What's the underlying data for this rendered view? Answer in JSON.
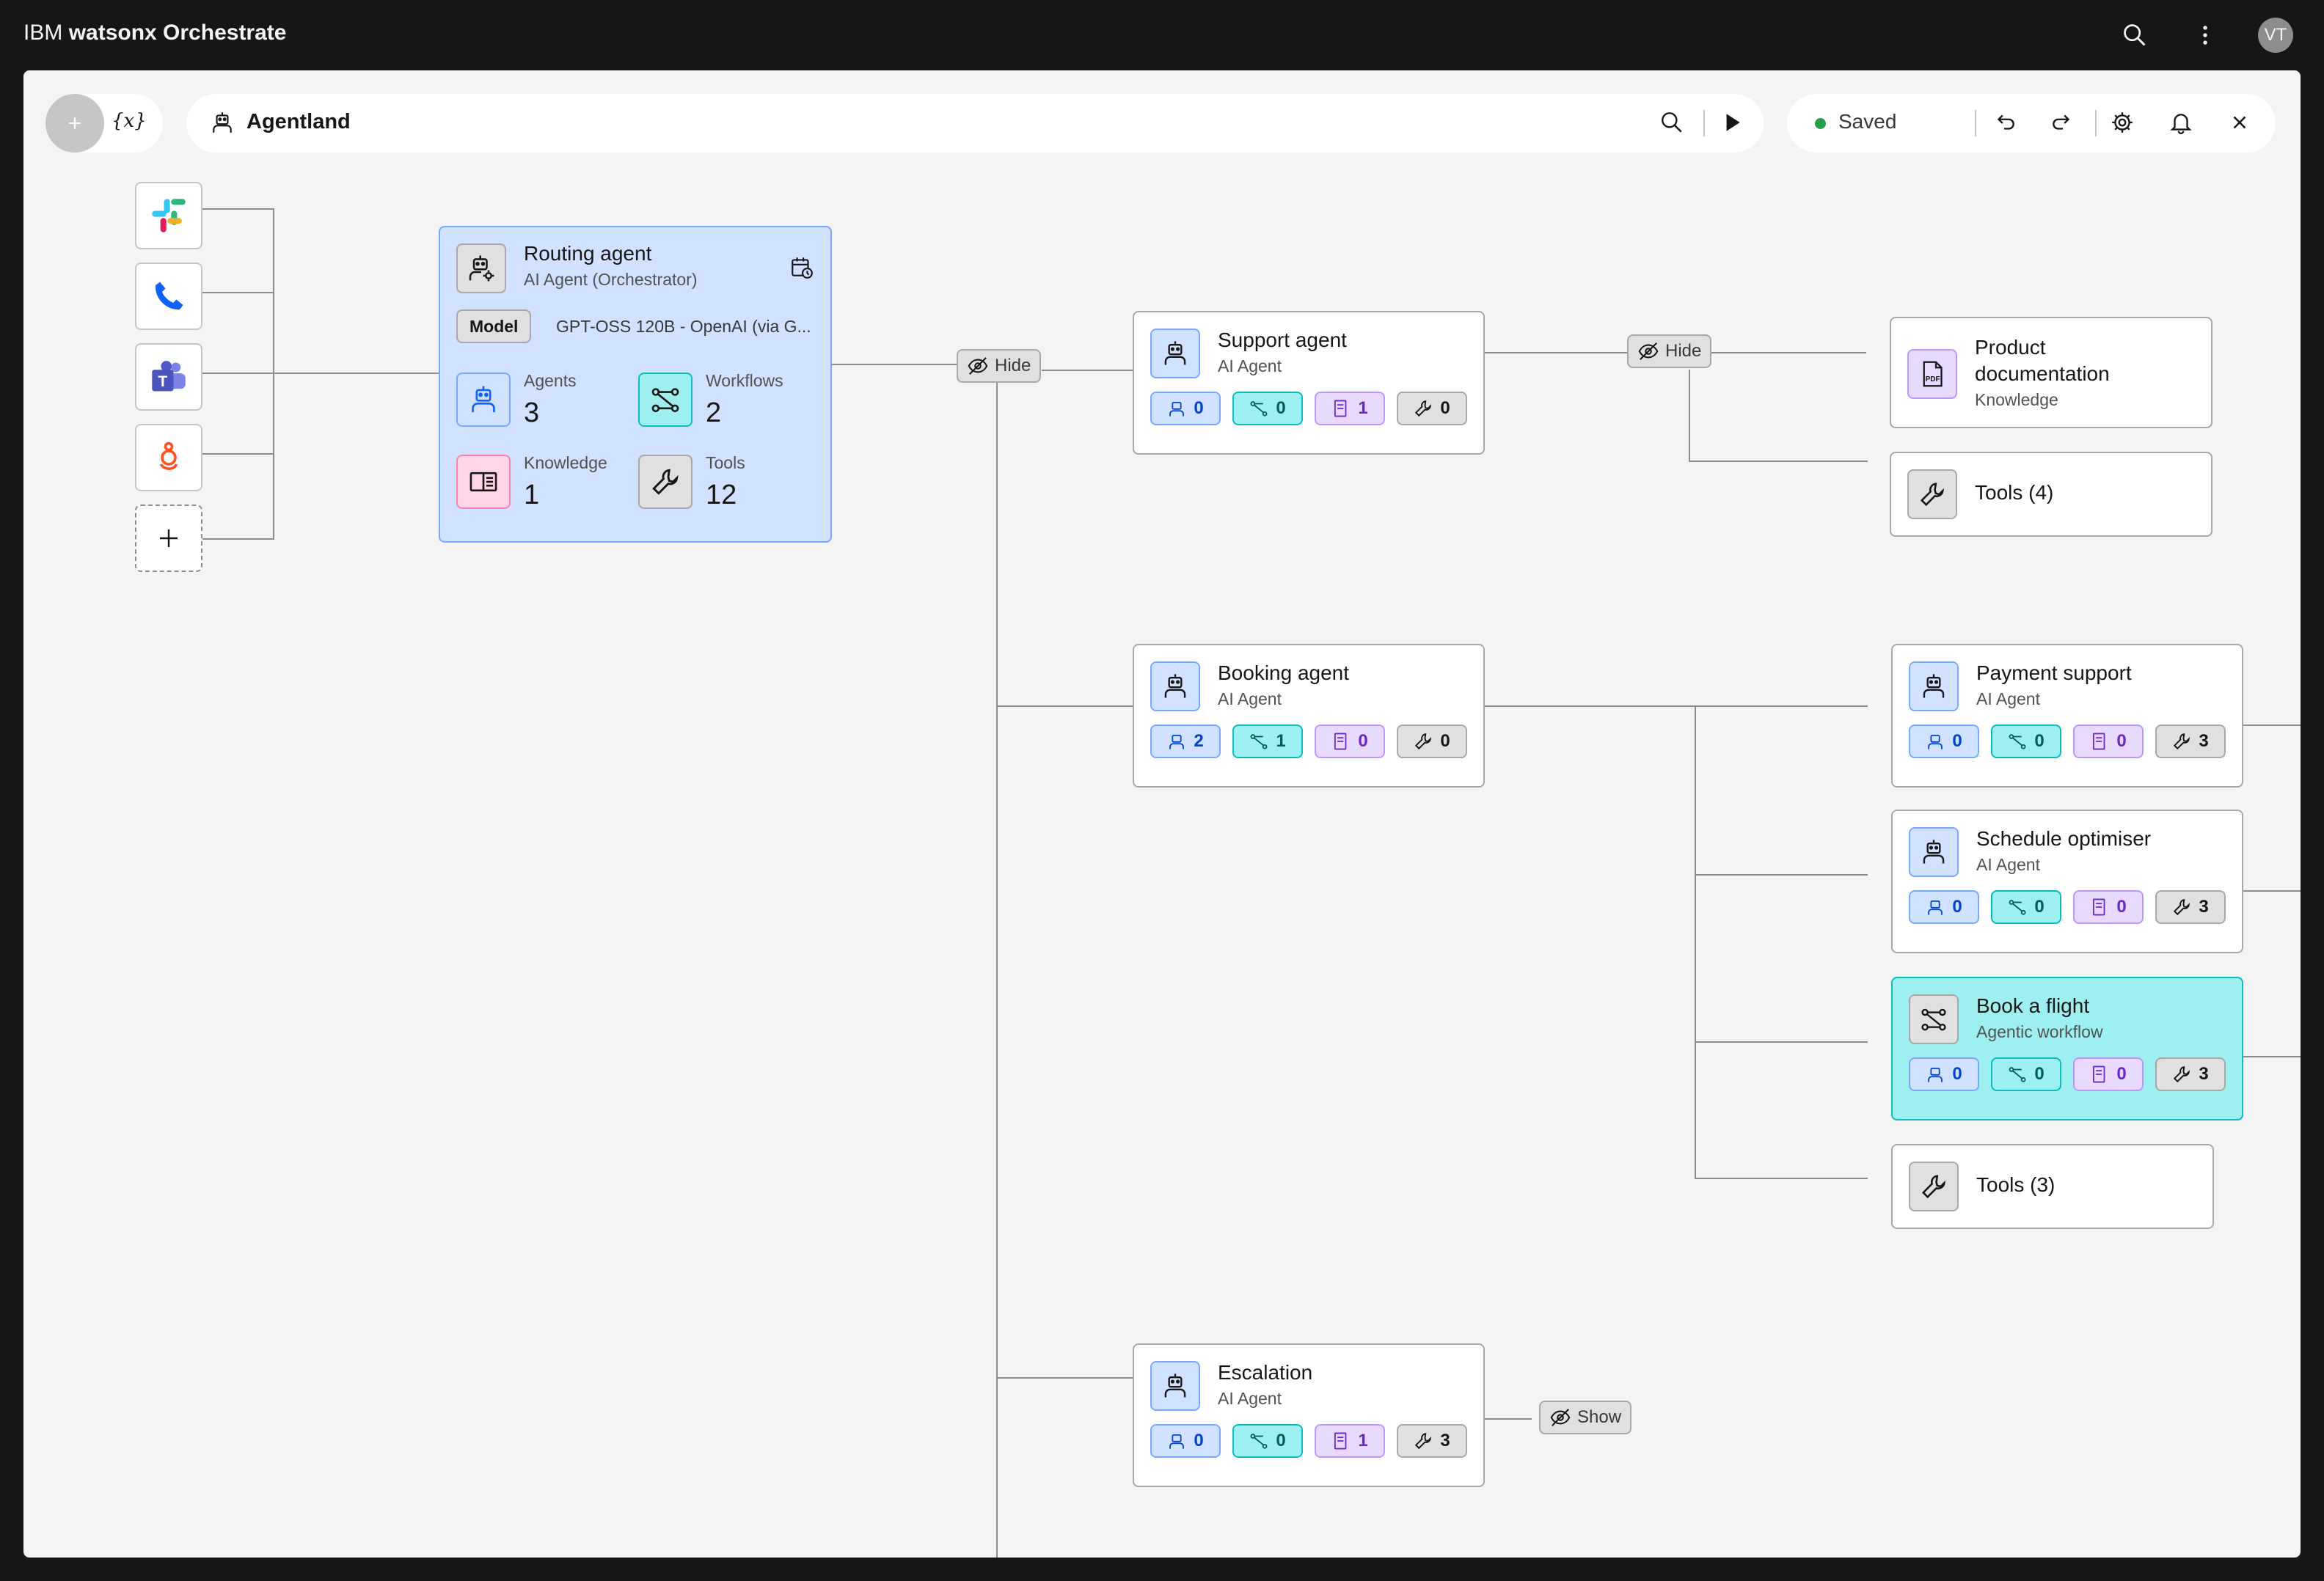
{
  "app": {
    "brand_prefix": "IBM",
    "brand_name": "watsonx Orchestrate",
    "avatar_initials": "VT"
  },
  "toolbar": {
    "variables_label": "{x}",
    "project_name": "Agentland",
    "status": "Saved"
  },
  "sources": [
    {
      "name": "slack-icon"
    },
    {
      "name": "phone-icon"
    },
    {
      "name": "teams-icon"
    },
    {
      "name": "genesys-icon"
    },
    {
      "name": "add-icon"
    }
  ],
  "routing": {
    "title": "Routing agent",
    "subtitle": "AI Agent (Orchestrator)",
    "model_label": "Model",
    "model_value": "GPT-OSS 120B - OpenAI (via G...",
    "stats": {
      "agents_label": "Agents",
      "agents_value": "3",
      "workflows_label": "Workflows",
      "workflows_value": "2",
      "knowledge_label": "Knowledge",
      "knowledge_value": "1",
      "tools_label": "Tools",
      "tools_value": "12"
    }
  },
  "toggles": {
    "hide": "Hide",
    "show": "Show"
  },
  "agents": {
    "support": {
      "title": "Support agent",
      "subtitle": "AI Agent",
      "counts": [
        "0",
        "0",
        "1",
        "0"
      ]
    },
    "booking": {
      "title": "Booking agent",
      "subtitle": "AI Agent",
      "counts": [
        "2",
        "1",
        "0",
        "0"
      ]
    },
    "escalation": {
      "title": "Escalation",
      "subtitle": "AI Agent",
      "counts": [
        "0",
        "0",
        "1",
        "3"
      ]
    },
    "payment": {
      "title": "Payment support",
      "subtitle": "AI Agent",
      "counts": [
        "0",
        "0",
        "0",
        "3"
      ]
    },
    "schedule": {
      "title": "Schedule optimiser",
      "subtitle": "AI Agent",
      "counts": [
        "0",
        "0",
        "0",
        "3"
      ]
    },
    "flight": {
      "title": "Book a flight",
      "subtitle": "Agentic workflow",
      "counts": [
        "0",
        "0",
        "0",
        "3"
      ]
    }
  },
  "product_doc": {
    "title_line1": "Product",
    "title_line2": "documentation",
    "subtitle": "Knowledge"
  },
  "tools_support": {
    "label": "Tools (4)"
  },
  "tools_booking": {
    "label": "Tools (3)"
  },
  "colors": {
    "canvas": "#f4f4f4",
    "topbar": "#161616",
    "routing_bg": "#d0e2ff",
    "workflow_bg": "#9ef0f0",
    "saved_dot": "#24a148"
  }
}
